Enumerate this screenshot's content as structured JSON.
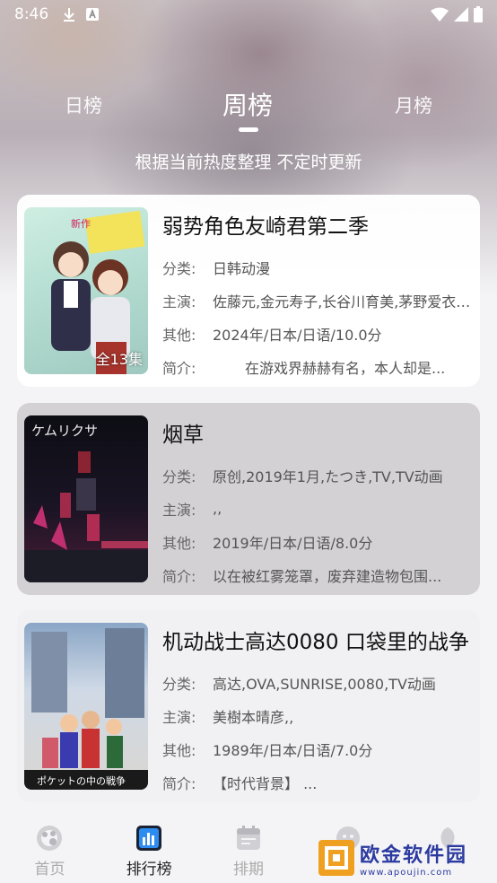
{
  "status_bar": {
    "time": "8:46"
  },
  "tabs": [
    {
      "label": "日榜",
      "active": false
    },
    {
      "label": "周榜",
      "active": true
    },
    {
      "label": "月榜",
      "active": false
    }
  ],
  "subtitle": "根据当前热度整理 不定时更新",
  "labels": {
    "category": "分类:",
    "cast": "主演:",
    "other": "其他:",
    "intro": "简介:"
  },
  "items": [
    {
      "title": "弱势角色友崎君第二季",
      "episodes": "全13集",
      "category": "日韩动漫",
      "cast": "佐藤元,金元寿子,长谷川育美,茅野爱衣,...",
      "other": "2024年/日本/日语/10.0分",
      "intro": "在游戏界赫赫有名，本人却是..."
    },
    {
      "title": "烟草",
      "poster_text": "ケムリクサ",
      "category": "原创,2019年1月,たつき,TV,TV动画",
      "cast": ",,",
      "other": "2019年/日本/日语/8.0分",
      "intro": "以在被红雾笼罩，废弃建造物包围..."
    },
    {
      "title": "机动战士高达0080 口袋里的战争",
      "category": "高达,OVA,SUNRISE,0080,TV动画",
      "cast": "美樹本晴彦,,",
      "other": "1989年/日本/日语/7.0分",
      "intro": "【时代背景】 ..."
    }
  ],
  "bottom_nav": [
    {
      "label": "首页",
      "icon": "palette-icon",
      "active": false
    },
    {
      "label": "排行榜",
      "icon": "chart-icon",
      "active": true
    },
    {
      "label": "排期",
      "icon": "calendar-icon",
      "active": false
    },
    {
      "label": "",
      "icon": "face-icon",
      "active": false
    },
    {
      "label": "",
      "icon": "leaf-icon",
      "active": false
    }
  ],
  "watermark": {
    "title": "欧金软件园",
    "sub": "www.apoujin.com"
  }
}
